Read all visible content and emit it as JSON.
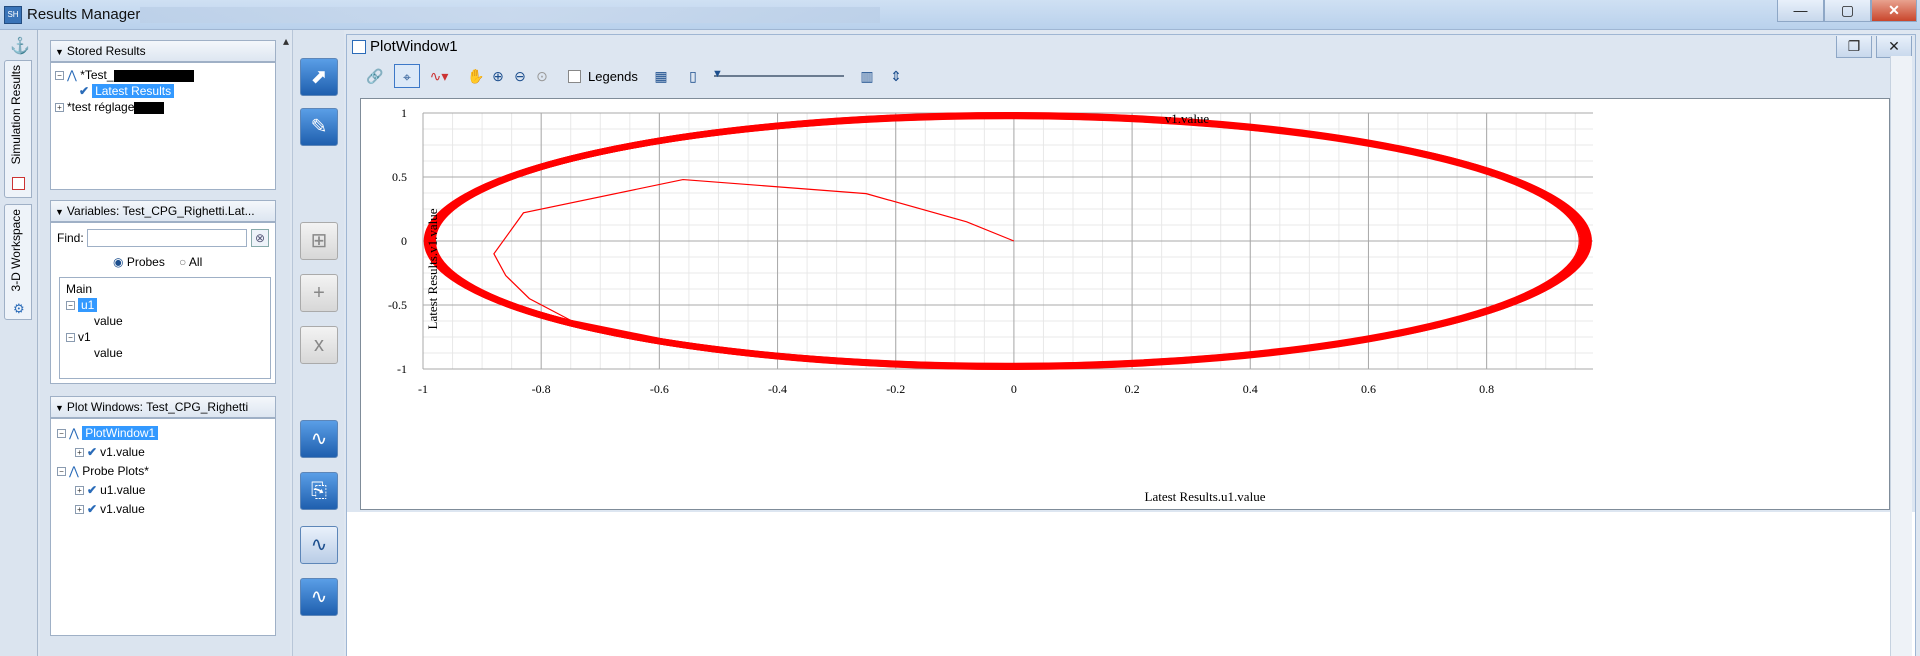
{
  "window": {
    "title": "Results Manager",
    "app_icon": "results-manager-icon",
    "controls": {
      "minimize": "—",
      "maximize": "▢",
      "close": "✕"
    }
  },
  "side_tabs": [
    {
      "label": "Simulation Results"
    },
    {
      "label": "3-D Workspace"
    }
  ],
  "stored_results": {
    "header": "Stored Results",
    "items": [
      {
        "label": "*Test_"
      },
      {
        "label": "Latest Results"
      },
      {
        "label": "*test réglage"
      }
    ]
  },
  "variables": {
    "header": "Variables: Test_CPG_Righetti.Lat...",
    "find_label": "Find:",
    "find_value": "",
    "probes_label": "Probes",
    "all_label": "All",
    "tree": [
      {
        "label": "Main"
      },
      {
        "label": "u1"
      },
      {
        "label": "value"
      },
      {
        "label": "v1"
      },
      {
        "label": "value"
      }
    ]
  },
  "plot_windows": {
    "header": "Plot Windows: Test_CPG_Righetti",
    "tree": [
      {
        "label": "PlotWindow1"
      },
      {
        "label": "v1.value"
      },
      {
        "label": "Probe Plots*"
      },
      {
        "label": "u1.value"
      },
      {
        "label": "v1.value"
      }
    ]
  },
  "plot_window": {
    "title": "PlotWindow1",
    "legends_label": "Legends",
    "legends_checked": false
  },
  "chart_data": {
    "type": "line",
    "title": "v1.value",
    "xlabel": "Latest Results.u1.value",
    "ylabel": "Latest Results.v1.value",
    "xlim": [
      -1,
      0.98
    ],
    "ylim": [
      -1,
      1
    ],
    "x_ticks": [
      "-1",
      "-0.8",
      "-0.6",
      "-0.4",
      "-0.2",
      "0",
      "0.2",
      "0.4",
      "0.6",
      "0.8"
    ],
    "y_ticks": [
      "1",
      "0.5",
      "0",
      "-0.5",
      "-1"
    ],
    "grid": true,
    "color": "#ff0000",
    "series": [
      {
        "limit_cycle": {
          "center_x": -0.01,
          "center_y": 0,
          "radius_x": 0.98,
          "radius_y": 0.98
        },
        "transient": [
          [
            0,
            0
          ],
          [
            -0.08,
            0.15
          ],
          [
            -0.25,
            0.37
          ],
          [
            -0.56,
            0.48
          ],
          [
            -0.83,
            0.22
          ],
          [
            -0.88,
            -0.1
          ],
          [
            -0.86,
            -0.27
          ],
          [
            -0.82,
            -0.45
          ],
          [
            -0.75,
            -0.62
          ],
          [
            -0.6,
            -0.76
          ]
        ]
      }
    ]
  }
}
